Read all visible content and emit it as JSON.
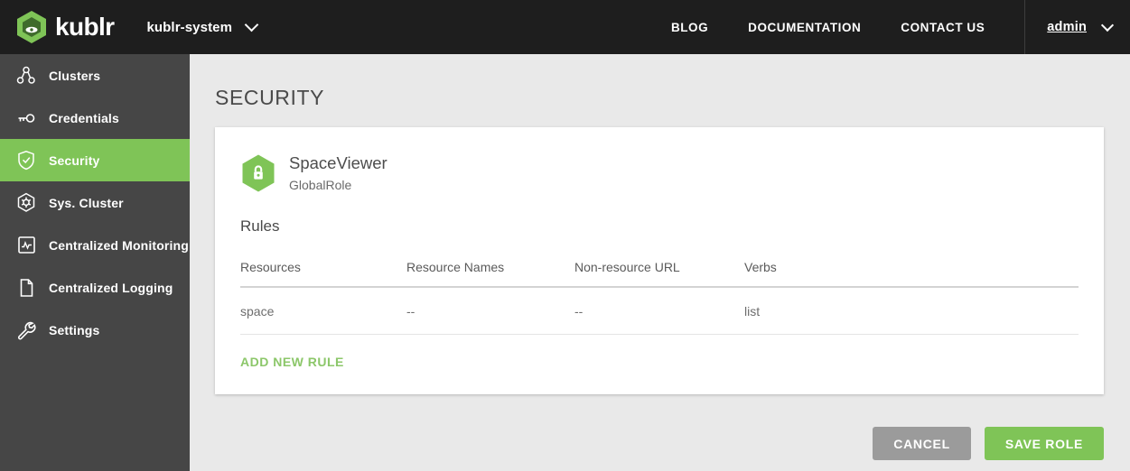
{
  "brand": {
    "name": "kublr",
    "logo_icon": "kublr-hexagon-logo"
  },
  "header": {
    "scope": {
      "label": "kublr-system",
      "chevron_icon": "chevron-down-icon"
    },
    "nav": [
      {
        "label": "BLOG"
      },
      {
        "label": "DOCUMENTATION"
      },
      {
        "label": "CONTACT US"
      }
    ],
    "user": {
      "label": "admin",
      "chevron_icon": "chevron-down-icon"
    }
  },
  "sidebar": {
    "items": [
      {
        "label": "Clusters",
        "icon": "nodes-icon",
        "active": false
      },
      {
        "label": "Credentials",
        "icon": "key-icon",
        "active": false
      },
      {
        "label": "Security",
        "icon": "shield-check-icon",
        "active": true
      },
      {
        "label": "Sys. Cluster",
        "icon": "hexagon-gear-icon",
        "active": false
      },
      {
        "label": "Centralized Monitoring",
        "icon": "chart-square-icon",
        "active": false
      },
      {
        "label": "Centralized Logging",
        "icon": "document-icon",
        "active": false
      },
      {
        "label": "Settings",
        "icon": "wrench-icon",
        "active": false
      }
    ]
  },
  "main": {
    "page_title": "SECURITY",
    "role": {
      "icon": "hexagon-lock-icon",
      "name": "SpaceViewer",
      "kind": "GlobalRole"
    },
    "rules": {
      "section_title": "Rules",
      "columns": [
        "Resources",
        "Resource Names",
        "Non-resource URL",
        "Verbs"
      ],
      "rows": [
        [
          "space",
          "--",
          "--",
          "list"
        ]
      ],
      "add_link": "ADD NEW RULE"
    },
    "footer": {
      "cancel_label": "CANCEL",
      "save_label": "SAVE ROLE"
    }
  },
  "colors": {
    "accent_green": "#7fc457",
    "link_green": "#8cc76a",
    "topbar": "#1e1e1e",
    "sidebar": "#464646",
    "page_bg": "#e9e9e9",
    "cancel_gray": "#9b9b9b"
  }
}
